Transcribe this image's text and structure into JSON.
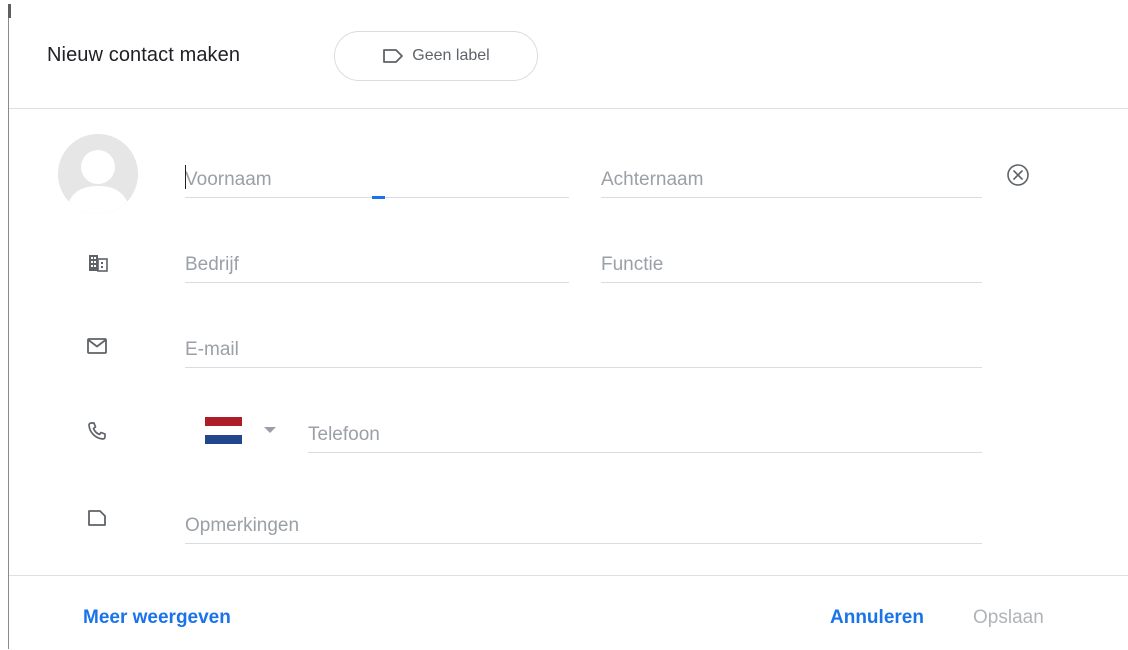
{
  "dialog": {
    "title": "Nieuw contact maken",
    "label_chip": "Geen label"
  },
  "fields": {
    "first_name": {
      "placeholder": "Voornaam",
      "value": ""
    },
    "last_name": {
      "placeholder": "Achternaam",
      "value": ""
    },
    "company": {
      "placeholder": "Bedrijf",
      "value": ""
    },
    "job_title": {
      "placeholder": "Functie",
      "value": ""
    },
    "email": {
      "placeholder": "E-mail",
      "value": ""
    },
    "phone": {
      "placeholder": "Telefoon",
      "value": "",
      "country_flag": "Netherlands"
    },
    "notes": {
      "placeholder": "Opmerkingen",
      "value": ""
    }
  },
  "icons": {
    "label": "label-outline-icon",
    "avatar": "person-avatar-icon",
    "clear": "clear-circle-icon",
    "company": "building-icon",
    "email": "mail-icon",
    "phone": "phone-icon",
    "notes": "note-icon",
    "dropdown": "triangle-down-icon"
  },
  "footer": {
    "more": "Meer weergeven",
    "cancel": "Annuleren",
    "save": "Opslaan"
  },
  "colors": {
    "accent": "#1a73e8",
    "disabled": "#b0b3b8",
    "flag_red": "#ae1c28",
    "flag_white": "#ffffff",
    "flag_blue": "#21468b"
  }
}
